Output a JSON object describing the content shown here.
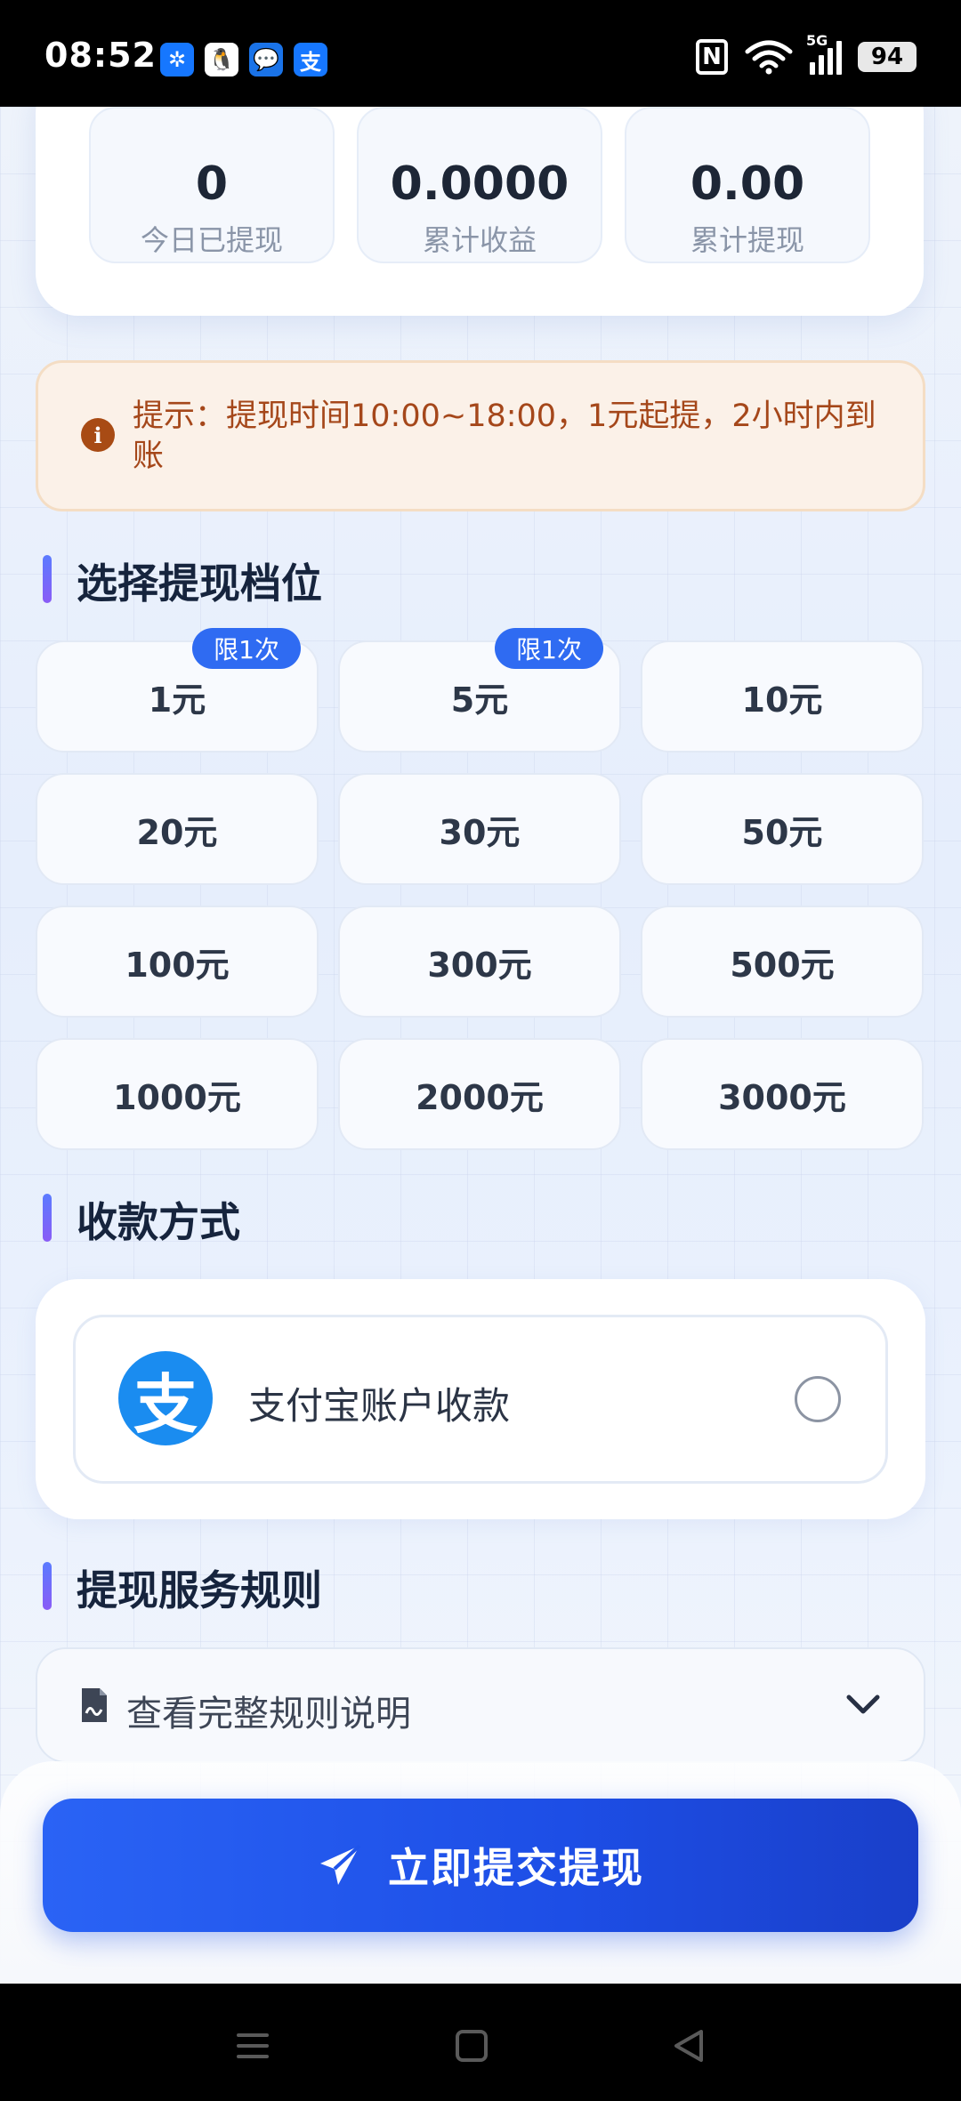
{
  "status_bar": {
    "time": "08:52",
    "notifications": [
      "windmill-app-icon",
      "qq-icon",
      "message-icon",
      "alipay-icon"
    ],
    "notification_glyphs": [
      "✲",
      "🐧",
      "💬",
      "支"
    ],
    "nfc_label": "N",
    "network_label": "5G",
    "battery": "94"
  },
  "stats": [
    {
      "value": "0",
      "label": "今日已提现"
    },
    {
      "value": "0.0000",
      "label": "累计收益"
    },
    {
      "value": "0.00",
      "label": "累计提现"
    }
  ],
  "tip": {
    "icon": "i",
    "text": "提示：提现时间10:00~18:00，1元起提，2小时内到账"
  },
  "tiers_section": {
    "title": "选择提现档位",
    "tiers": [
      {
        "label": "1元",
        "badge": "限1次"
      },
      {
        "label": "5元",
        "badge": "限1次"
      },
      {
        "label": "10元",
        "badge": ""
      },
      {
        "label": "20元",
        "badge": ""
      },
      {
        "label": "30元",
        "badge": ""
      },
      {
        "label": "50元",
        "badge": ""
      },
      {
        "label": "100元",
        "badge": ""
      },
      {
        "label": "300元",
        "badge": ""
      },
      {
        "label": "500元",
        "badge": ""
      },
      {
        "label": "1000元",
        "badge": ""
      },
      {
        "label": "2000元",
        "badge": ""
      },
      {
        "label": "3000元",
        "badge": ""
      }
    ]
  },
  "payment_section": {
    "title": "收款方式",
    "logo_glyph": "支",
    "option_label": "支付宝账户收款",
    "selected": false
  },
  "rules_section": {
    "title": "提现服务规则",
    "toggle_label": "查看完整规则说明"
  },
  "submit": {
    "label": "立即提交提现"
  },
  "colors": {
    "primary": "#2a63f5",
    "tip_text": "#a5471a",
    "badge": "#2f6bf2",
    "alipay": "#1a8cf0"
  }
}
